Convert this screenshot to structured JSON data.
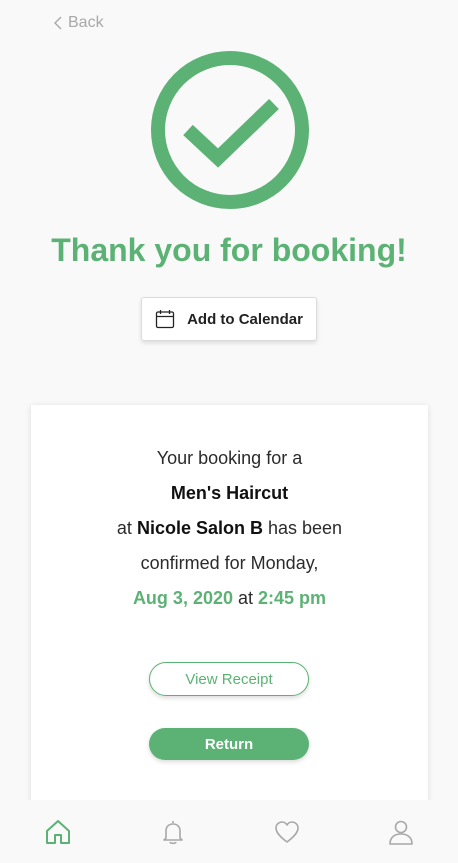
{
  "header": {
    "back_label": "Back"
  },
  "confirmation": {
    "title": "Thank you for booking!",
    "add_to_calendar_label": "Add to Calendar"
  },
  "booking": {
    "line1": "Your booking for a",
    "service": "Men's Haircut",
    "at_prefix": "at",
    "salon": "Nicole Salon B",
    "status_suffix": "has been",
    "line4": "confirmed for Monday,",
    "date": "Aug 3, 2020",
    "at_word": "at",
    "time": "2:45 pm"
  },
  "actions": {
    "view_receipt_label": "View Receipt",
    "return_label": "Return"
  },
  "tabs": [
    {
      "icon": "home-icon",
      "active": true
    },
    {
      "icon": "bell-icon",
      "active": false
    },
    {
      "icon": "heart-icon",
      "active": false
    },
    {
      "icon": "profile-icon",
      "active": false
    }
  ],
  "colors": {
    "accent": "#5cb274",
    "inactive_icon": "#a8a8a8",
    "background": "#f9f9f9"
  }
}
